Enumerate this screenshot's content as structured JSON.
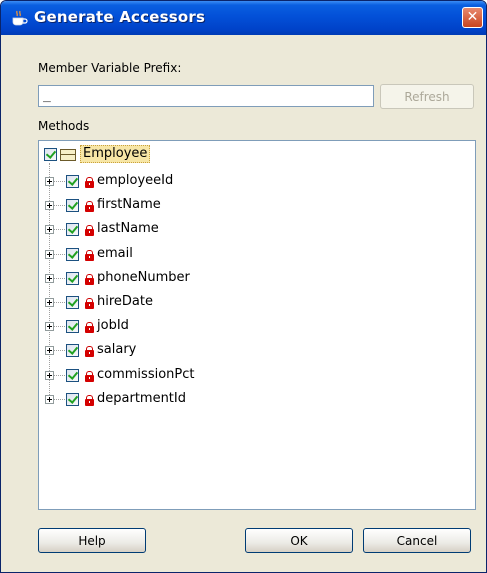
{
  "window": {
    "title": "Generate Accessors",
    "close_glyph": "✕",
    "title_icon": "coffee-cup-icon"
  },
  "prefix": {
    "label": "Member Variable Prefix:",
    "value": "_",
    "refresh_label": "Refresh"
  },
  "methods": {
    "label": "Methods",
    "root": {
      "label": "Employee",
      "checked": true
    },
    "fields": [
      {
        "name": "employeeId",
        "checked": true
      },
      {
        "name": "firstName",
        "checked": true
      },
      {
        "name": "lastName",
        "checked": true
      },
      {
        "name": "email",
        "checked": true
      },
      {
        "name": "phoneNumber",
        "checked": true
      },
      {
        "name": "hireDate",
        "checked": true
      },
      {
        "name": "jobId",
        "checked": true
      },
      {
        "name": "salary",
        "checked": true
      },
      {
        "name": "commissionPct",
        "checked": true
      },
      {
        "name": "departmentId",
        "checked": true
      }
    ]
  },
  "buttons": {
    "help": "Help",
    "ok": "OK",
    "cancel": "Cancel"
  },
  "colors": {
    "title_bar": "#0350d8",
    "dialog_bg": "#ece9d8",
    "check": "#21a121",
    "lock": "#d40000",
    "root_highlight": "#f7e6a6"
  }
}
